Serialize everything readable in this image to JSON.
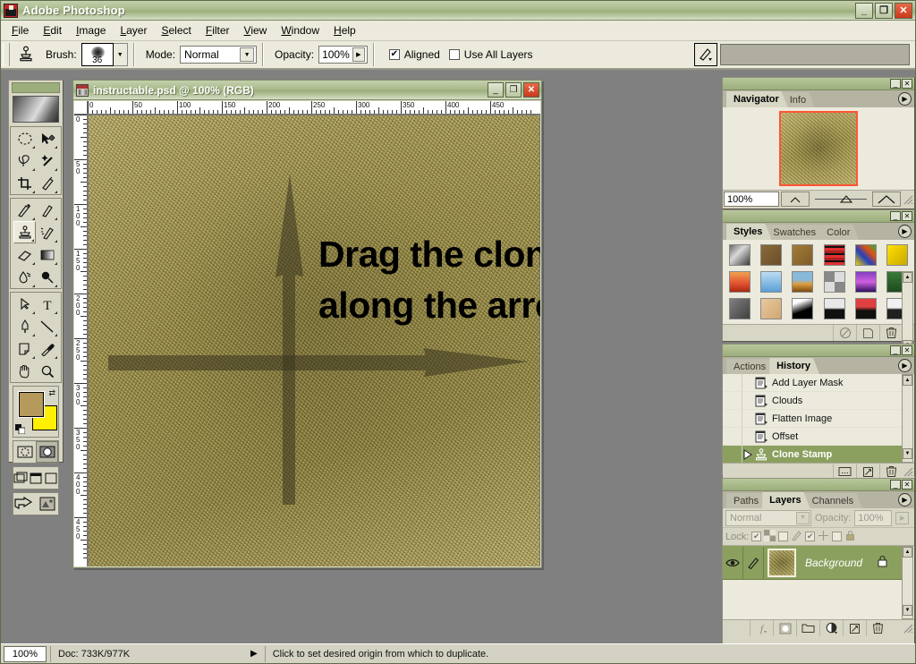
{
  "app": {
    "title": "Adobe Photoshop",
    "icon": "photoshop-icon",
    "window_buttons": {
      "minimize": "_",
      "maximize": "❐",
      "close": "✕"
    }
  },
  "menu": {
    "items": [
      {
        "label": "File"
      },
      {
        "label": "Edit"
      },
      {
        "label": "Image"
      },
      {
        "label": "Layer"
      },
      {
        "label": "Select"
      },
      {
        "label": "Filter"
      },
      {
        "label": "View"
      },
      {
        "label": "Window"
      },
      {
        "label": "Help"
      }
    ]
  },
  "options_bar": {
    "tool_icon": "clone-stamp-icon",
    "brush_label": "Brush:",
    "brush_size": "36",
    "mode_label": "Mode:",
    "mode_value": "Normal",
    "opacity_label": "Opacity:",
    "opacity_value": "100%",
    "aligned_label": "Aligned",
    "aligned_checked": "✔",
    "use_all_layers_label": "Use All Layers",
    "use_all_layers_checked": "",
    "brush_preset_icon": "brush-preset-icon"
  },
  "toolbox": {
    "tools": [
      {
        "name": "marquee-tool",
        "icon": "ellipse-marquee-icon"
      },
      {
        "name": "move-tool",
        "icon": "move-icon"
      },
      {
        "name": "lasso-tool",
        "icon": "lasso-icon"
      },
      {
        "name": "magic-wand-tool",
        "icon": "magic-wand-icon"
      },
      {
        "name": "crop-tool",
        "icon": "crop-icon"
      },
      {
        "name": "slice-tool",
        "icon": "slice-icon"
      },
      {
        "name": "healing-brush-tool",
        "icon": "healing-brush-icon"
      },
      {
        "name": "brush-tool",
        "icon": "paintbrush-icon"
      },
      {
        "name": "clone-stamp-tool",
        "icon": "clone-stamp-icon",
        "active": true
      },
      {
        "name": "history-brush-tool",
        "icon": "history-brush-icon"
      },
      {
        "name": "eraser-tool",
        "icon": "eraser-icon"
      },
      {
        "name": "gradient-tool",
        "icon": "gradient-icon"
      },
      {
        "name": "blur-tool",
        "icon": "blur-icon"
      },
      {
        "name": "dodge-tool",
        "icon": "dodge-icon"
      },
      {
        "name": "path-selection-tool",
        "icon": "path-arrow-icon"
      },
      {
        "name": "type-tool",
        "icon": "type-t-icon"
      },
      {
        "name": "pen-tool",
        "icon": "pen-icon"
      },
      {
        "name": "line-tool",
        "icon": "line-icon"
      },
      {
        "name": "notes-tool",
        "icon": "notes-icon"
      },
      {
        "name": "eyedropper-tool",
        "icon": "eyedropper-icon"
      },
      {
        "name": "hand-tool",
        "icon": "hand-icon"
      },
      {
        "name": "zoom-tool",
        "icon": "magnifier-icon"
      }
    ],
    "foreground_color": "#b59a5c",
    "background_color": "#ffef00",
    "mask_modes": [
      {
        "name": "standard-mode",
        "selected": false
      },
      {
        "name": "quick-mask-mode",
        "selected": true
      }
    ],
    "screen_modes": [
      {
        "name": "standard-screen-mode"
      },
      {
        "name": "full-screen-with-menubar-mode"
      },
      {
        "name": "full-screen-mode"
      }
    ],
    "jump_to_imageready": "jump-to-imageready-icon"
  },
  "document": {
    "title": "instructable.psd @ 100% (RGB)",
    "icon": "document-icon",
    "buttons": {
      "minimize": "_",
      "maximize": "❐",
      "close": "✕"
    },
    "ruler_units_h": [
      "0",
      "50",
      "100",
      "150",
      "200",
      "250",
      "300",
      "350",
      "400",
      "450"
    ],
    "ruler_units_v": [
      "0",
      "50",
      "100",
      "150",
      "200",
      "250",
      "300",
      "350",
      "400",
      "450"
    ],
    "overlay_text_line1": "Drag the clone tool",
    "overlay_text_line2": "along the arrows",
    "canvas_content": "tan-textured-photo-with-two-dark-arrows"
  },
  "navigator_panel": {
    "tabs": [
      {
        "label": "Navigator",
        "active": true
      },
      {
        "label": "Info",
        "active": false
      }
    ],
    "zoom_value": "100%",
    "thumbnail_border_color": "#ff5533",
    "menu_icon": "panel-menu-icon"
  },
  "styles_panel": {
    "tabs": [
      {
        "label": "Styles",
        "active": true
      },
      {
        "label": "Swatches",
        "active": false
      },
      {
        "label": "Color",
        "active": false
      }
    ],
    "swatches": [
      "linear-gradient(135deg,#6a6a6a,#d8d8d8 40%,#3a3a3a)",
      "linear-gradient(135deg,#8a6a3a,#6b4f28)",
      "linear-gradient(135deg,#a37b3a,#7d5c27)",
      "repeating-linear-gradient(0deg,#e03030 0 3px,#101010 3px 5px,#b02020 5px 8px)",
      "linear-gradient(45deg,#f0d000,#2040c0 40%,#e05010 70%,#30b040)",
      "linear-gradient(135deg,#ffe000,#c8a800)",
      "linear-gradient(180deg,#f0a050,#e05030 60%,#a82810)",
      "linear-gradient(180deg,#bdddf5,#5a9fd4)",
      "linear-gradient(180deg,#8ab8d8 40%,#e0a040 60%,#7a4a10)",
      "repeating-conic-gradient(#ddd 0 25%,#888 0 50%)",
      "linear-gradient(180deg,#8040c0,#d060e0 50%,#301060)",
      "linear-gradient(180deg,#3a7a3a,#1e4a1e)",
      "linear-gradient(135deg,#808080,#404040)",
      "linear-gradient(135deg,#e8c8a0,#d0a870)",
      "linear-gradient(160deg,#ffffff 20%,#000000 60%)",
      "linear-gradient(180deg,#e8e8e8 45%,#101010 55%)",
      "linear-gradient(180deg,#e04040 40%,#101010 60%)",
      "linear-gradient(180deg,#f0f0f0 45%,#202020 55%)"
    ],
    "footer_buttons": [
      {
        "name": "clear-style-button",
        "icon": "no-style-icon"
      },
      {
        "name": "new-style-button",
        "icon": "new-page-icon"
      },
      {
        "name": "delete-style-button",
        "icon": "trash-icon"
      }
    ]
  },
  "history_panel": {
    "tabs": [
      {
        "label": "Actions",
        "active": false
      },
      {
        "label": "History",
        "active": true
      }
    ],
    "items": [
      {
        "label": "Add Layer Mask",
        "selected": false
      },
      {
        "label": "Clouds",
        "selected": false
      },
      {
        "label": "Flatten Image",
        "selected": false
      },
      {
        "label": "Offset",
        "selected": false
      },
      {
        "label": "Clone Stamp",
        "selected": true
      }
    ],
    "footer_buttons": [
      {
        "name": "new-document-from-state-button",
        "icon": "new-doc-icon"
      },
      {
        "name": "new-snapshot-button",
        "icon": "snapshot-icon"
      },
      {
        "name": "delete-state-button",
        "icon": "trash-icon"
      }
    ]
  },
  "layers_panel": {
    "tabs": [
      {
        "label": "Paths",
        "active": false
      },
      {
        "label": "Layers",
        "active": true
      },
      {
        "label": "Channels",
        "active": false
      }
    ],
    "blend_mode": "Normal",
    "opacity_label": "Opacity:",
    "opacity_value": "100%",
    "lock_label": "Lock:",
    "lock_options": [
      {
        "name": "lock-transparent-pixels",
        "checked": true,
        "icon": "checkerboard-icon"
      },
      {
        "name": "lock-image-pixels",
        "checked": false,
        "icon": "brush-icon"
      },
      {
        "name": "lock-position",
        "checked": true,
        "icon": "move-cross-icon"
      },
      {
        "name": "lock-all",
        "checked": false,
        "icon": "padlock-icon"
      }
    ],
    "layers": [
      {
        "name": "Background",
        "visible": true,
        "locked": true,
        "selected": true,
        "eye_icon": "eye-icon",
        "brush_icon": "brush-icon",
        "lock_icon": "padlock-icon"
      }
    ],
    "footer_buttons": [
      {
        "name": "layer-style-button",
        "icon": "fx-icon"
      },
      {
        "name": "add-layer-mask-button",
        "icon": "mask-icon"
      },
      {
        "name": "new-group-button",
        "icon": "folder-icon"
      },
      {
        "name": "adjustment-layer-button",
        "icon": "half-circle-icon"
      },
      {
        "name": "new-layer-button",
        "icon": "new-page-icon"
      },
      {
        "name": "delete-layer-button",
        "icon": "trash-icon"
      }
    ]
  },
  "status_bar": {
    "zoom": "100%",
    "doc_info": "Doc: 733K/977K",
    "hint": "Click to set desired origin from which to duplicate.",
    "triangle_icon": "play-triangle-icon"
  },
  "colors": {
    "titlebar_green": "#9cae7c",
    "panel_bg": "#d8d6c4",
    "selection_green": "#8ba05f",
    "canvas_backdrop": "#808080",
    "close_red": "#c8391a"
  }
}
